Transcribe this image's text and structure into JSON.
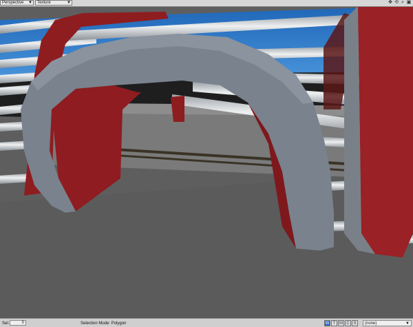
{
  "viewport": {
    "view_mode": "Perspective",
    "shading_mode": "Texture",
    "icons": [
      "move-view-icon",
      "rotate-view-icon",
      "zoom-view-icon",
      "maximize-view-icon"
    ]
  },
  "status": {
    "sel_label": "Sel:",
    "sel_value": "0",
    "selection_mode": "Selection Mode:  Polygon",
    "mode_buttons": [
      "W",
      "T",
      "M",
      "C",
      "S"
    ],
    "surface_value": "(none)"
  },
  "colors": {
    "sky": "#2a7ad0",
    "floor": "#5d5d5d",
    "wall": "#7c7c7c",
    "red": "#8e1c1f",
    "grey_arch": "#7b8490"
  }
}
